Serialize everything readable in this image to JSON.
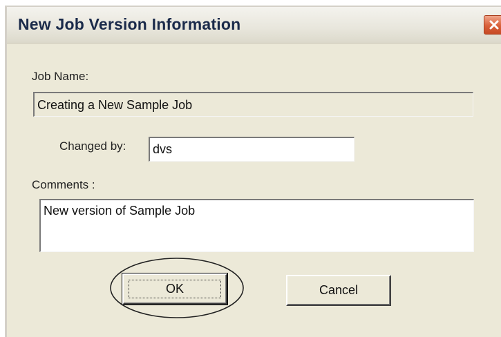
{
  "window": {
    "title": "New Job Version Information"
  },
  "icons": {
    "close": "close-icon"
  },
  "job_name": {
    "label": "Job Name:",
    "value": "Creating a New Sample Job"
  },
  "changed_by": {
    "label": "Changed by:",
    "value": "dvs"
  },
  "comments": {
    "label": "Comments :",
    "value": "New version of Sample Job"
  },
  "buttons": {
    "ok_label": "OK",
    "cancel_label": "Cancel"
  },
  "colors": {
    "dialog_background": "#ece9d8",
    "close_button": "#d9603a",
    "title_text": "#1a2a4a"
  }
}
